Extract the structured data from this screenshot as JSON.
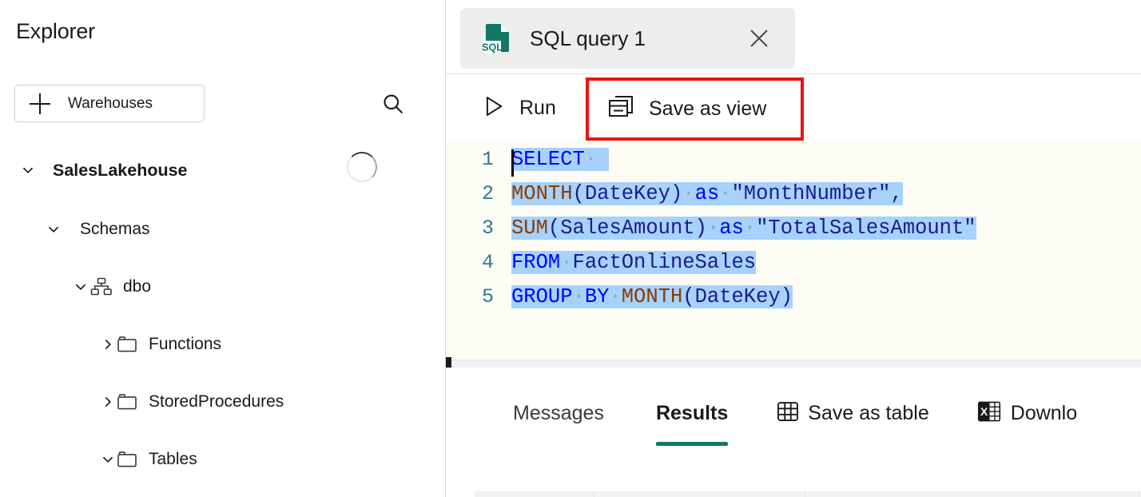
{
  "sidebar": {
    "title": "Explorer",
    "add_button": {
      "label": "Warehouses",
      "icon": "plus-icon"
    },
    "search_icon": "search-icon",
    "loading_indicator": "spinner-icon",
    "tree": [
      {
        "label": "SalesLakehouse",
        "chevron": "chevron-down",
        "icon": null,
        "bold": true
      },
      {
        "label": "Schemas",
        "chevron": "chevron-down",
        "icon": null,
        "bold": false
      },
      {
        "label": "dbo",
        "chevron": "chevron-down",
        "icon": "schema-icon",
        "bold": false
      },
      {
        "label": "Functions",
        "chevron": "chevron-right",
        "icon": "folder-icon",
        "bold": false
      },
      {
        "label": "StoredProcedures",
        "chevron": "chevron-right",
        "icon": "folder-icon",
        "bold": false
      },
      {
        "label": "Tables",
        "chevron": "chevron-down",
        "icon": "folder-icon",
        "bold": false
      }
    ]
  },
  "tab": {
    "title": "SQL query 1",
    "icon": "sql-file-icon",
    "icon_text": "SQL",
    "close_icon": "close-icon"
  },
  "toolbar": {
    "run_label": "Run",
    "run_icon": "play-icon",
    "save_as_view_label": "Save as view",
    "save_as_view_icon": "view-stack-icon",
    "highlight_color": "#ee1111"
  },
  "editor": {
    "lines": [
      "1",
      "2",
      "3",
      "4",
      "5"
    ],
    "code": [
      "SELECT ",
      "MONTH(DateKey) as \"MonthNumber\",",
      "SUM(SalesAmount) as \"TotalSalesAmount\"",
      "FROM FactOnlineSales",
      "GROUP BY MONTH(DateKey)"
    ],
    "selection_color": "#a6d2fb",
    "linenumber_color": "#2d7d8f",
    "background": "#fdfdf6"
  },
  "results": {
    "tabs": [
      {
        "label": "Messages",
        "active": false
      },
      {
        "label": "Results",
        "active": true
      }
    ],
    "actions": [
      {
        "label": "Save as table",
        "icon": "table-grid-icon"
      },
      {
        "label": "Downlo",
        "icon": "excel-icon"
      }
    ],
    "active_underline_color": "#117865"
  }
}
